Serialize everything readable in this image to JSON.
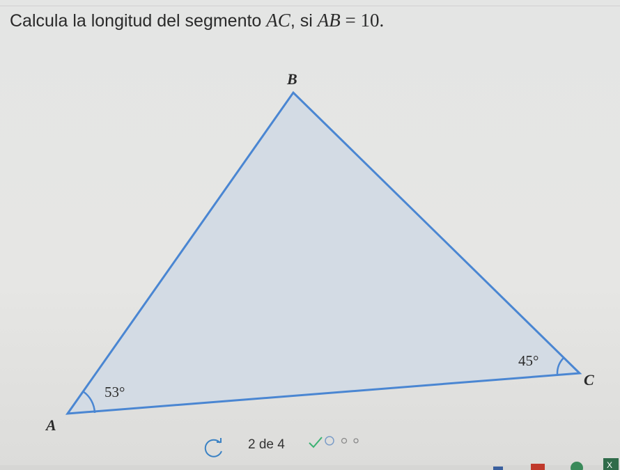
{
  "question": {
    "prefix": "Calcula la longitud del segmento ",
    "segment": "AC",
    "middle": ", si ",
    "known_segment": "AB",
    "equals": " = ",
    "known_value": "10",
    "suffix": "."
  },
  "figure": {
    "vertex_a": "A",
    "vertex_b": "B",
    "vertex_c": "C",
    "angle_a": "53°",
    "angle_c": "45°",
    "fill_color": "#d3dbe4",
    "stroke_color": "#4a86d2"
  },
  "progress": {
    "label": "2 de 4",
    "retry_icon": "retry-icon",
    "completed_icon": "check-icon"
  },
  "taskbar": {
    "excel_label": "X"
  }
}
